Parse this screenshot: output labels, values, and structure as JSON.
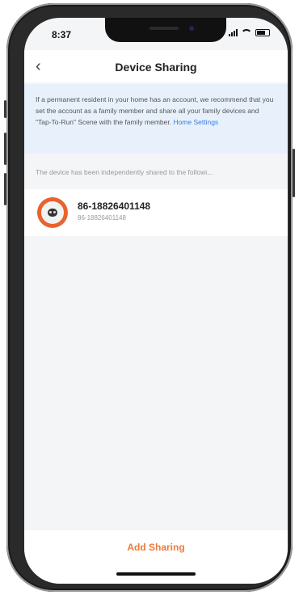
{
  "status_bar": {
    "time": "8:37"
  },
  "navbar": {
    "title": "Device Sharing"
  },
  "info": {
    "text": "If a permanent resident in your home has an account, we recommend that you set the account as a family member and share all your family devices and \"Tap-To-Run\" Scene with the family member.",
    "link_label": "Home Settings"
  },
  "section_label": "The device has been independently shared to the followi...",
  "shared_users": [
    {
      "title": "86-18826401148",
      "subtitle": "86-18826401148"
    }
  ],
  "actions": {
    "add_sharing_label": "Add Sharing"
  },
  "colors": {
    "accent": "#ee7a3a",
    "link": "#3b7ddc",
    "info_bg": "#e8f1fb"
  }
}
